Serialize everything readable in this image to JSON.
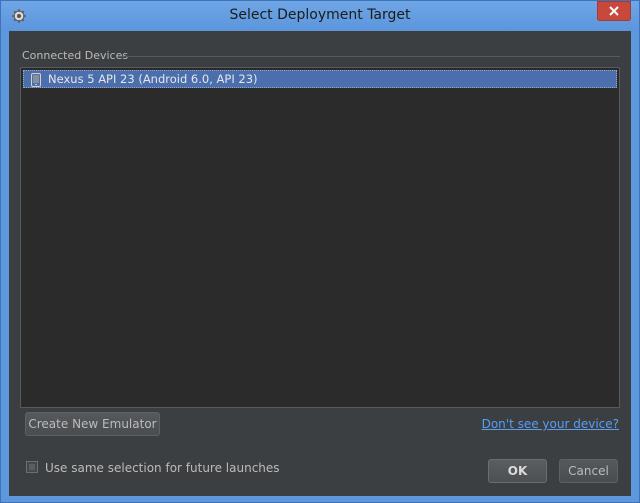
{
  "window": {
    "title": "Select Deployment Target",
    "app_icon": "android-studio-icon",
    "close_icon": "close-icon"
  },
  "devices": {
    "group_title": "Connected Devices",
    "items": [
      {
        "label": "Nexus 5 API 23 (Android 6.0, API 23)",
        "icon": "phone-icon",
        "selected": true
      }
    ]
  },
  "actions": {
    "create_emulator": "Create New Emulator",
    "help_link": "Don't see your device?",
    "remember_label": "Use same selection for future launches",
    "ok": "OK",
    "cancel": "Cancel"
  },
  "colors": {
    "title_bar": "#5f97dc",
    "panel": "#3c3f41",
    "selection": "#4b6eaf",
    "link": "#589df6"
  }
}
